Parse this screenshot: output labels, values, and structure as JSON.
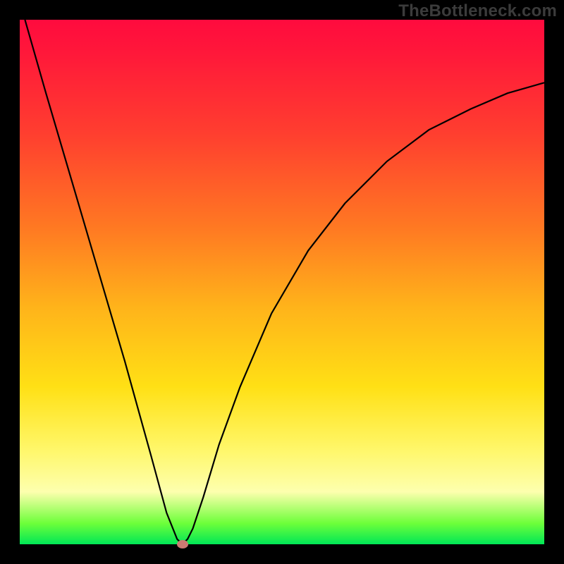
{
  "watermark": "TheBottleneck.com",
  "chart_data": {
    "type": "line",
    "title": "",
    "xlabel": "",
    "ylabel": "",
    "xlim": [
      0,
      100
    ],
    "ylim": [
      0,
      100
    ],
    "grid": false,
    "legend": false,
    "background_gradient": {
      "stops": [
        {
          "pos": 0,
          "color": "#ff0b3e"
        },
        {
          "pos": 22,
          "color": "#ff3f2f"
        },
        {
          "pos": 40,
          "color": "#ff7a22"
        },
        {
          "pos": 55,
          "color": "#ffb41a"
        },
        {
          "pos": 70,
          "color": "#ffe015"
        },
        {
          "pos": 82,
          "color": "#fff76a"
        },
        {
          "pos": 90,
          "color": "#fdffae"
        },
        {
          "pos": 96,
          "color": "#6dff3a"
        },
        {
          "pos": 100,
          "color": "#00e756"
        }
      ]
    },
    "series": [
      {
        "name": "bottleneck-curve",
        "color": "#000000",
        "x": [
          1,
          5,
          10,
          15,
          20,
          25,
          28,
          30,
          31,
          32,
          33,
          35,
          38,
          42,
          48,
          55,
          62,
          70,
          78,
          86,
          93,
          100
        ],
        "y": [
          100,
          86,
          69,
          52,
          35,
          17,
          6,
          1,
          0,
          1,
          3,
          9,
          19,
          30,
          44,
          56,
          65,
          73,
          79,
          83,
          86,
          88
        ]
      }
    ],
    "annotations": [
      {
        "name": "min-point-marker",
        "x": 31,
        "y": 0,
        "color": "#cc7a72",
        "shape": "ellipse"
      }
    ]
  }
}
